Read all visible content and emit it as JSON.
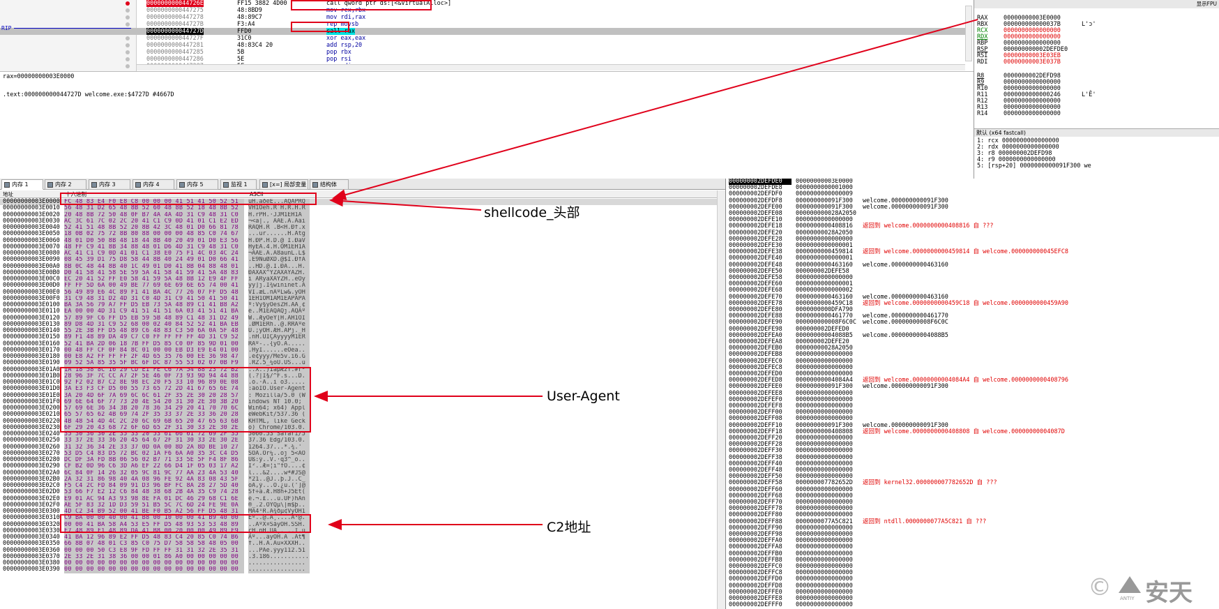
{
  "disasm": {
    "rip_label": "RIP",
    "rows": [
      {
        "addr": "000000000044726E",
        "bytes": "FF15 3882 4D00",
        "instr": "call qword ptr ds:[<&VirtualAlloc>]"
      },
      {
        "addr": "0000000000447275",
        "bytes": "48:8BD9",
        "instr": "mov rcx,rbx"
      },
      {
        "addr": "0000000000447278",
        "bytes": "48:89C7",
        "instr": "mov rdi,rax"
      },
      {
        "addr": "000000000044727B",
        "bytes": "F3:A4",
        "instr": "rep movsb"
      },
      {
        "addr": "000000000044727D",
        "bytes": "FFD0",
        "instr": "call rax"
      },
      {
        "addr": "000000000044727F",
        "bytes": "31C0",
        "instr": "xor eax,eax"
      },
      {
        "addr": "0000000000447281",
        "bytes": "48:83C4 20",
        "instr": "add rsp,20"
      },
      {
        "addr": "0000000000447285",
        "bytes": "5B",
        "instr": "pop rbx"
      },
      {
        "addr": "0000000000447286",
        "bytes": "5E",
        "instr": "pop rsi"
      },
      {
        "addr": "0000000000447287",
        "bytes": "5F",
        "instr": "pop rdi"
      }
    ]
  },
  "info": {
    "line1": "rax=00000000003E0000",
    "line2": ".text:000000000044727D welcome.exe:$4727D #4667D"
  },
  "regs": {
    "header": "显示FPU",
    "rows": [
      {
        "n": "RAX",
        "v": "00000000003E0000",
        "c": ""
      },
      {
        "n": "RBX",
        "v": "000000000000037B",
        "c": "L'ɔ'"
      },
      {
        "n": "RCX",
        "v": "0000000000000000",
        "c": ""
      },
      {
        "n": "RDX",
        "v": "0000000000000000",
        "c": ""
      },
      {
        "n": "RBP",
        "v": "0000000000000000",
        "c": ""
      },
      {
        "n": "RSP",
        "v": "000000000002DEFDE0",
        "c": ""
      },
      {
        "n": "RSI",
        "v": "00000000003E03EB",
        "c": ""
      },
      {
        "n": "RDI",
        "v": "00000000003E037B",
        "c": ""
      },
      {
        "n": "R8",
        "v": "0000000002DEFD98",
        "c": ""
      },
      {
        "n": "R9",
        "v": "0000000000000000",
        "c": ""
      },
      {
        "n": "R10",
        "v": "0000000000000000",
        "c": ""
      },
      {
        "n": "R11",
        "v": "0000000000000246",
        "c": "L'Ȇ'"
      },
      {
        "n": "R12",
        "v": "0000000000000000",
        "c": ""
      },
      {
        "n": "R13",
        "v": "0000000000000000",
        "c": ""
      },
      {
        "n": "R14",
        "v": "0000000000000000",
        "c": ""
      }
    ],
    "callconv": "默认 (x64 fastcall)",
    "args": [
      "1: rcx 0000000000000000",
      "2: rdx 0000000000000000",
      "3: r8 000000002DEFD98",
      "4: r9 0000000000000000",
      "5: [rsp+20] 0000000000091F300 we"
    ]
  },
  "tabs": [
    {
      "label": "内存 1",
      "active": true
    },
    {
      "label": "内存 2"
    },
    {
      "label": "内存 3"
    },
    {
      "label": "内存 4"
    },
    {
      "label": "内存 5"
    },
    {
      "label": "监视 1"
    },
    {
      "label": "[x=] 局部变量"
    },
    {
      "label": "结构体"
    }
  ],
  "memhdr": {
    "addr": "地址",
    "hex": "十六进制",
    "ascii": "ASCII"
  },
  "dump": [
    {
      "a": "00000000003E0000",
      "h": "FC 48 83 E4 F0 E8 C8 00 00 00 41 51 41 50 52 51",
      "s": "üH.äðèÈ...AQAPRQ"
    },
    {
      "a": "00000000003E0010",
      "h": "56 48 31 D2 65 48 8B 52 60 48 8B 52 18 48 8B 52",
      "s": "VH1Òeh.R`H.R.H.R"
    },
    {
      "a": "00000000003E0020",
      "h": "20 48 8B 72 50 48 0F B7 4A 4A 4D 31 C9 48 31 C0",
      "s": " H.rPH.·JJM1ÉH1À"
    },
    {
      "a": "00000000003E0030",
      "h": "AC 3C 61 7C 02 2C 20 41 C1 C9 0D 41 01 C1 E2 ED",
      "s": "¬<a|., AÁÉ.A.Áâí"
    },
    {
      "a": "00000000003E0040",
      "h": "52 41 51 48 8B 52 20 8B 42 3C 48 01 D0 66 81 78",
      "s": "RAQH.R .B<H.Ðf.x"
    },
    {
      "a": "00000000003E0050",
      "h": "18 0B 02 75 72 8B 80 88 00 00 00 48 85 C0 74 67",
      "s": "...ur......H.Àtg"
    },
    {
      "a": "00000000003E0060",
      "h": "48 01 D0 50 8B 48 18 44 8B 40 20 49 01 D0 E3 56",
      "s": "H.ÐP.H.D.@ I.ÐãV"
    },
    {
      "a": "00000000003E0070",
      "h": "48 FF C9 41 8B 34 88 48 01 D6 4D 31 C9 48 31 C0",
      "s": "HÿÉA.4.H.ÖM1ÉH1À"
    },
    {
      "a": "00000000003E0080",
      "h": "AC 41 C1 C9 0D 41 01 C1 38 E0 75 F1 4C 03 4C 24",
      "s": "¬AÁÉ.A.Á8àuñL.L$"
    },
    {
      "a": "00000000003E0090",
      "h": "08 45 39 D1 75 D8 58 44 8B 40 24 49 01 D0 66 41",
      "s": ".E9ÑuØXD.@$I.ÐfA"
    },
    {
      "a": "00000000003E00A0",
      "h": "8B 0C 48 44 8B 40 1C 49 01 D0 41 8B 04 88 48 01",
      "s": "..HD.@.I.ÐA...H."
    },
    {
      "a": "00000000003E00B0",
      "h": "D0 41 58 41 58 5E 59 5A 41 58 41 59 41 5A 48 83",
      "s": "ÐAXAX^YZAXAYAZH."
    },
    {
      "a": "00000000003E00C0",
      "h": "EC 20 41 52 FF E0 58 41 59 5A 48 8B 12 E9 4F FF",
      "s": "ì ARÿàXAYZH..éOÿ"
    },
    {
      "a": "00000000003E00D0",
      "h": "FF FF 5D 6A 00 49 BE 77 69 6E 69 6E 65 74 00 41",
      "s": "ÿÿ]j.I¾wininet.A"
    },
    {
      "a": "00000000003E00E0",
      "h": "56 49 89 E6 4C 89 F1 41 BA 4C 77 26 07 FF D5 48",
      "s": "VI.æL.ñAºLw&.ÿÕH"
    },
    {
      "a": "00000000003E00F0",
      "h": "31 C9 48 31 D2 4D 31 C0 4D 31 C9 41 50 41 50 41",
      "s": "1ÉH1ÒM1ÀM1ÉAPAPA"
    },
    {
      "a": "00000000003E0100",
      "h": "BA 3A 56 79 A7 FF D5 EB 73 5A 48 89 C1 41 B8 A2",
      "s": "º:Vy§ÿÕësZH.ÁA¸¢"
    },
    {
      "a": "00000000003E0110",
      "h": "EA 00 00 4D 31 C9 41 51 41 51 6A 03 41 51 41 BA",
      "s": "ê..M1ÉAQAQj.AQAº"
    },
    {
      "a": "00000000003E0120",
      "h": "57 89 9F C6 FF D5 EB 59 5B 48 89 C1 48 31 D2 49",
      "s": "W..ÆÿÕëY[H.ÁH1ÒI"
    },
    {
      "a": "00000000003E0130",
      "h": "89 D8 4D 31 C9 52 68 00 02 40 84 52 52 41 BA EB",
      "s": ".ØM1ÉRh..@.RRAºë"
    },
    {
      "a": "00000000003E0140",
      "h": "55 2E 3B FF D5 48 89 C6 48 83 C3 50 6A 0A 5F 48",
      "s": "U.;ÿÕH.ÆH.ÃPj._H"
    },
    {
      "a": "00000000003E0150",
      "h": "89 F1 48 89 DA 49 C7 C0 FF FF FF FF 4D 31 C9 52",
      "s": ".ñH.ÚIÇÀÿÿÿÿM1ÉR"
    },
    {
      "a": "00000000003E0160",
      "h": "52 41 BA 2D 06 18 7B FF D5 85 C0 0F 85 9D 01 00",
      "s": "RAº-..{ÿÕ.À....."
    },
    {
      "a": "00000000003E0170",
      "h": "00 48 FF CF 0F 84 8C 01 00 00 EB D3 E9 E4 01 00",
      "s": ".HÿÏ......ëÓéä.."
    },
    {
      "a": "00000000003E0180",
      "h": "00 E8 A2 FF FF FF 2F 4D 65 35 76 00 EE 36 98 47",
      "s": ".è¢ÿÿÿ/Me5v.î6.G"
    },
    {
      "a": "00000000003E0190",
      "h": "09 52 5A 85 35 5F BC 6F DC 87 55 53 02 07 0B F9",
      "s": ".RZ.5_¼oÜ.US...ù"
    },
    {
      "a": "00000000003E01A0",
      "h": "1A 18 58 8C 16 29 CD E1 FE C6 7A 54 88 23 72 B2",
      "s": "..X..)ÍáþÆzT.#r²"
    },
    {
      "a": "00000000003E01B0",
      "h": "28 96 3F 7C CC A7 2F 5E 46 0F 73 93 9D 94 44 88",
      "s": "(.?|Ì§/^F.s...D."
    },
    {
      "a": "00000000003E01C0",
      "h": "92 F2 02 B7 C2 8E 98 EC 20 F5 33 10 96 89 0E 08",
      "s": ".ò.·Â..ì õ3....."
    },
    {
      "a": "00000000003E01D0",
      "h": "3A E3 F3 CF D5 00 55 73 65 72 2D 41 67 65 6E 74",
      "s": ":ãóÏÕ.User-Agent"
    },
    {
      "a": "00000000003E01E0",
      "h": "3A 20 4D 6F 7A 69 6C 6C 61 2F 35 2E 30 20 28 57",
      "s": ": Mozilla/5.0 (W"
    },
    {
      "a": "00000000003E01F0",
      "h": "69 6E 64 6F 77 73 20 4E 54 20 31 30 2E 30 3B 20",
      "s": "indows NT 10.0; "
    },
    {
      "a": "00000000003E0200",
      "h": "57 69 6E 36 34 3B 20 78 36 34 29 20 41 70 70 6C",
      "s": "Win64; x64) Appl"
    },
    {
      "a": "00000000003E0210",
      "h": "65 57 65 62 4B 69 74 2F 35 33 37 2E 33 36 20 28",
      "s": "eWebKit/537.36 ("
    },
    {
      "a": "00000000003E0220",
      "h": "4B 48 54 4D 4C 2C 20 6C 69 6B 65 20 47 65 63 6B",
      "s": "KHTML, like Geck"
    },
    {
      "a": "00000000003E0230",
      "h": "6F 29 20 43 68 72 6F 6D 65 2F 31 30 33 2E 30 2E",
      "s": "o) Chrome/103.0."
    },
    {
      "a": "00000000003E0240",
      "h": "35 30 36 30 2E 35 33 20 53 61 66 61 72 69 2F 35",
      "s": "5060.53 Safari/5"
    },
    {
      "a": "00000000003E0250",
      "h": "33 37 2E 33 36 20 45 64 67 2F 31 30 33 2E 30 2E",
      "s": "37.36 Edg/103.0."
    },
    {
      "a": "00000000003E0260",
      "h": "31 32 36 34 2E 33 37 0D 0A 00 8D 2A 8D BE 10 27",
      "s": "1264.37...*.¾.'"
    },
    {
      "a": "00000000003E0270",
      "h": "53 D5 C4 83 D5 72 BC 02 1A F6 6A A0 35 3C C4 D5",
      "s": "SÕÄ.Õr¼..öj 5<ÄÕ"
    },
    {
      "a": "00000000003E0280",
      "h": "DC DF 3A FD 8B 06 56 02 B7 71 33 5E 5F F4 8F 86",
      "s": "Üß:ý..V.·q3^_ô.."
    },
    {
      "a": "00000000003E0290",
      "h": "CF B2 0D 96 C6 3D A6 EF 22 66 D4 1F 05 03 17 A2",
      "s": "Ï²..Æ=¦ï\"fÔ....¢"
    },
    {
      "a": "00000000003E02A0",
      "h": "6C 84 0F 14 26 32 05 9C 81 9C 77 AA 23 4A 53 40",
      "s": "l...&2....wª#JS@"
    },
    {
      "a": "00000000003E02B0",
      "h": "2A 32 31 86 98 40 4A 08 96 FE 92 4A 83 08 43 5F",
      "s": "*21..@J..þ.J..C_"
    },
    {
      "a": "00000000003E02C0",
      "h": "F5 C4 2C FD 84 09 91 D3 96 BF FC 8A 28 27 5D 40",
      "s": "õÄ,ý...Ó.¿ü.(']@"
    },
    {
      "a": "00000000003E02D0",
      "h": "53 66 F7 E2 12 C6 84 48 38 68 2B 4A 35 C9 74 28",
      "s": "Sf÷â.Æ.H8h+J5Ét("
    },
    {
      "a": "00000000003E02E0",
      "h": "E9 01 AC 94 A3 93 98 8E FA 01 DC 46 29 68 C1 6E",
      "s": "é.¬.£...ú.ÜF)hÁn"
    },
    {
      "a": "00000000003E02F0",
      "h": "AE 5F 83 32 1D D3 59 51 B5 5C 7C 6D 24 FE 9E 0A",
      "s": "®_.2.ÓYQµ\\|m$þ.."
    },
    {
      "a": "00000000003E0300",
      "h": "4D C2 34 B9 52 00 41 BE F0 B5 A2 56 FF D5 48 31",
      "s": "MÂ4¹R.A¾ðµ¢VÿÕH1"
    },
    {
      "a": "00000000003E0310",
      "h": "C9 BA 00 00 40 00 41 B8 00 10 00 00 41 B9 40 00",
      "s": "Éº..@.A¸....A¹@."
    },
    {
      "a": "00000000003E0320",
      "h": "00 00 41 BA 58 A4 53 E5 FF D5 48 93 53 53 48 89",
      "s": "..AºX¤SåÿÕH.SSH."
    },
    {
      "a": "00000000003E0330",
      "h": "E7 48 89 F1 48 89 DA 41 B8 00 20 00 00 49 89 F9",
      "s": "çH.ñH.ÚA¸. ..I.ù"
    },
    {
      "a": "00000000003E0340",
      "h": "41 BA 12 96 89 E2 FF D5 48 83 C4 20 85 C0 74 B6",
      "s": "Aº...âÿÕH.Ä .Àt¶"
    },
    {
      "a": "00000000003E0350",
      "h": "66 8B 07 48 01 C3 85 C0 75 D7 58 58 58 48 05 00",
      "s": "f..H.Ã.Àu×XXXH.."
    },
    {
      "a": "00000000003E0360",
      "h": "00 00 00 50 C3 E8 9F FD FF FF 31 31 32 2E 35 31",
      "s": "...PÃè.ýÿÿ112.51"
    },
    {
      "a": "00000000003E0370",
      "h": "2E 33 2E 31 38 36 00 00 01 86 A0 00 00 00 00 00",
      "s": ".3.186..........."
    },
    {
      "a": "00000000003E0380",
      "h": "00 00 00 00 00 00 00 00 00 00 00 00 00 00 00 00",
      "s": "................"
    },
    {
      "a": "00000000003E0390",
      "h": "00 00 00 00 00 00 00 00 00 00 00 00 00 00 00 00",
      "s": "................"
    }
  ],
  "stack": [
    {
      "a": "000000002DEFDE0",
      "v": "00000000003E0000",
      "c": ""
    },
    {
      "a": "000000002DEFDE8",
      "v": "0000000000001000",
      "c": ""
    },
    {
      "a": "000000002DEFDF0",
      "v": "0000000000000009",
      "c": ""
    },
    {
      "a": "000000002DEFDF8",
      "v": "000000000091F300",
      "c": "welcome.000000000091F300"
    },
    {
      "a": "000000002DEFE00",
      "v": "000000000091F300",
      "c": "welcome.000000000091F300"
    },
    {
      "a": "000000002DEFE08",
      "v": "000000000028A2050",
      "c": ""
    },
    {
      "a": "000000002DEFE10",
      "v": "0000000000000000",
      "c": ""
    },
    {
      "a": "000000002DEFE18",
      "v": "0000000000408816",
      "c": "返回到 welcome.0000000000408816 自 ???",
      "r": true
    },
    {
      "a": "000000002DEFE20",
      "v": "00000000028A2050",
      "c": ""
    },
    {
      "a": "000000002DEFE28",
      "v": "0000000000000000",
      "c": ""
    },
    {
      "a": "000000002DEFE30",
      "v": "0000000000000001",
      "c": ""
    },
    {
      "a": "000000002DEFE38",
      "v": "0000000000459814",
      "c": "返回到 welcome.0000000000459814 自 welcome.000000000045EFC8",
      "r": true
    },
    {
      "a": "000000002DEFE40",
      "v": "0000000000000001",
      "c": ""
    },
    {
      "a": "000000002DEFE48",
      "v": "0000000000463160",
      "c": "welcome.0000000000463160"
    },
    {
      "a": "000000002DEFE50",
      "v": "000000002DEFE58",
      "c": ""
    },
    {
      "a": "000000002DEFE58",
      "v": "0000000000000000",
      "c": ""
    },
    {
      "a": "000000002DEFE60",
      "v": "0000000000000001",
      "c": ""
    },
    {
      "a": "000000002DEFE68",
      "v": "0000000000000002",
      "c": ""
    },
    {
      "a": "000000002DEFE70",
      "v": "0000000000463160",
      "c": "welcome.0000000000463160"
    },
    {
      "a": "000000002DEFE78",
      "v": "0000000000459C18",
      "c": "返回到 welcome.0000000000459C18 自 welcome.0000000000459A90",
      "r": true
    },
    {
      "a": "000000002DEFE80",
      "v": "0000000000DFA790",
      "c": ""
    },
    {
      "a": "000000002DEFE88",
      "v": "0000000000461770",
      "c": "welcome.0000000000461770"
    },
    {
      "a": "000000002DEFE90",
      "v": "000000000008F6C0C",
      "c": "welcome.00000000008F6C0C"
    },
    {
      "a": "000000002DEFE98",
      "v": "000000002DEFED0",
      "c": ""
    },
    {
      "a": "000000002DEFEA0",
      "v": "00000000004088B5",
      "c": "welcome.00000000004088B5"
    },
    {
      "a": "000000002DEFEA8",
      "v": "000000002DEFE20",
      "c": ""
    },
    {
      "a": "000000002DEFEB0",
      "v": "00000000028A2050",
      "c": ""
    },
    {
      "a": "000000002DEFEB8",
      "v": "0000000000000000",
      "c": ""
    },
    {
      "a": "000000002DEFEC0",
      "v": "0000000000000000",
      "c": ""
    },
    {
      "a": "000000002DEFEC8",
      "v": "0000000000000000",
      "c": ""
    },
    {
      "a": "000000002DEFED0",
      "v": "0000000000000000",
      "c": ""
    },
    {
      "a": "000000002DEFED8",
      "v": "00000000004084A4",
      "c": "返回到 welcome.00000000004084A4 自 welcome.0000000000408796",
      "r": true
    },
    {
      "a": "000000002DEFEE0",
      "v": "000000000091F300",
      "c": "welcome.000000000091F300"
    },
    {
      "a": "000000002DEFEE8",
      "v": "0000000000000000",
      "c": ""
    },
    {
      "a": "000000002DEFEF0",
      "v": "0000000000000000",
      "c": ""
    },
    {
      "a": "000000002DEFEF8",
      "v": "0000000000000000",
      "c": ""
    },
    {
      "a": "000000002DEFF00",
      "v": "0000000000000000",
      "c": ""
    },
    {
      "a": "000000002DEFF08",
      "v": "0000000000000000",
      "c": ""
    },
    {
      "a": "000000002DEFF10",
      "v": "000000000091F300",
      "c": "welcome.000000000091F300"
    },
    {
      "a": "000000002DEFF18",
      "v": "0000000000408808",
      "c": "返回到 welcome.0000000000408808 自 welcome.00000000004087D",
      "r": true
    },
    {
      "a": "000000002DEFF20",
      "v": "0000000000000000",
      "c": ""
    },
    {
      "a": "000000002DEFF28",
      "v": "0000000000000000",
      "c": ""
    },
    {
      "a": "000000002DEFF30",
      "v": "0000000000000000",
      "c": ""
    },
    {
      "a": "000000002DEFF38",
      "v": "0000000000000000",
      "c": ""
    },
    {
      "a": "000000002DEFF40",
      "v": "0000000000000000",
      "c": ""
    },
    {
      "a": "000000002DEFF48",
      "v": "0000000000000000",
      "c": ""
    },
    {
      "a": "000000002DEFF50",
      "v": "0000000000000000",
      "c": ""
    },
    {
      "a": "000000002DEFF58",
      "v": "000000007782652D",
      "c": "返回到 kernel32.000000007782652D 自 ???",
      "r": true
    },
    {
      "a": "000000002DEFF60",
      "v": "0000000000000000",
      "c": ""
    },
    {
      "a": "000000002DEFF68",
      "v": "0000000000000000",
      "c": ""
    },
    {
      "a": "000000002DEFF70",
      "v": "0000000000000000",
      "c": ""
    },
    {
      "a": "000000002DEFF78",
      "v": "0000000000000000",
      "c": ""
    },
    {
      "a": "000000002DEFF80",
      "v": "0000000000000000",
      "c": ""
    },
    {
      "a": "000000002DEFF88",
      "v": "0000000077A5C821",
      "c": "返回到 ntdll.0000000077A5C821 自 ???",
      "r": true
    },
    {
      "a": "000000002DEFF90",
      "v": "0000000000000000",
      "c": ""
    },
    {
      "a": "000000002DEFF98",
      "v": "0000000000000000",
      "c": ""
    },
    {
      "a": "000000002DEFFA0",
      "v": "0000000000000000",
      "c": ""
    },
    {
      "a": "000000002DEFFA8",
      "v": "0000000000000000",
      "c": ""
    },
    {
      "a": "000000002DEFFB0",
      "v": "0000000000000000",
      "c": ""
    },
    {
      "a": "000000002DEFFB8",
      "v": "0000000000000000",
      "c": ""
    },
    {
      "a": "000000002DEFFC0",
      "v": "0000000000000000",
      "c": ""
    },
    {
      "a": "000000002DEFFC8",
      "v": "0000000000000000",
      "c": ""
    },
    {
      "a": "000000002DEFFD0",
      "v": "0000000000000000",
      "c": ""
    },
    {
      "a": "000000002DEFFD8",
      "v": "0000000000000000",
      "c": ""
    },
    {
      "a": "000000002DEFFE0",
      "v": "0000000000000000",
      "c": ""
    },
    {
      "a": "000000002DEFFE8",
      "v": "0000000000000000",
      "c": ""
    },
    {
      "a": "000000002DEFFF0",
      "v": "0000000000000000",
      "c": ""
    }
  ],
  "annotations": {
    "shellcode": "shellcode_头部",
    "useragent": "User-Agent",
    "c2": "C2地址"
  },
  "watermark": {
    "symbol": "©",
    "brand": "安天",
    "sub": "ANTIY"
  },
  "colors": {
    "annot_red": "#e0001a",
    "selection": "#c0c0c0",
    "purple_hex": "#800080"
  }
}
